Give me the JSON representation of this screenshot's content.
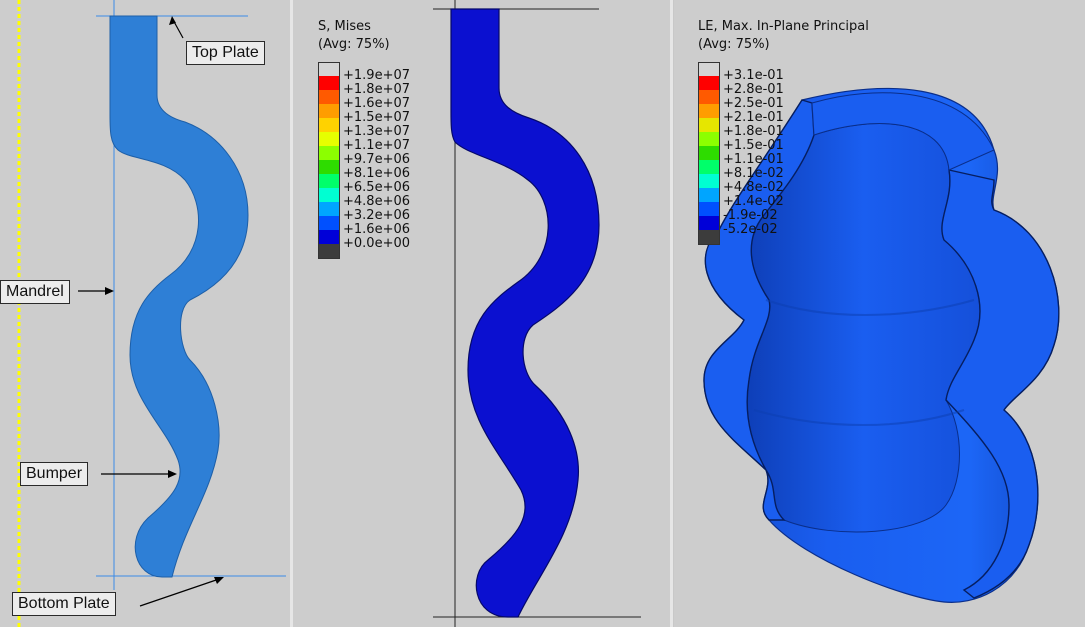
{
  "callouts": {
    "top_plate": "Top Plate",
    "mandrel": "Mandrel",
    "bumper": "Bumper",
    "bottom_plate": "Bottom Plate"
  },
  "stress_legend": {
    "title": "S, Mises",
    "subtitle": "(Avg: 75%)",
    "labels": [
      "+1.9e+07",
      "+1.8e+07",
      "+1.6e+07",
      "+1.5e+07",
      "+1.3e+07",
      "+1.1e+07",
      "+9.7e+06",
      "+8.1e+06",
      "+6.5e+06",
      "+4.8e+06",
      "+3.2e+06",
      "+1.6e+06",
      "+0.0e+00"
    ]
  },
  "strain_legend": {
    "title": "LE, Max. In-Plane Principal",
    "subtitle": "(Avg: 75%)",
    "labels": [
      "+3.1e-01",
      "+2.8e-01",
      "+2.5e-01",
      "+2.1e-01",
      "+1.8e-01",
      "+1.5e-01",
      "+1.1e-01",
      "+8.1e-02",
      "+4.8e-02",
      "+1.4e-02",
      "-1.9e-02",
      "-5.2e-02"
    ]
  },
  "colors": {
    "background": "#cdcdcd",
    "bumper_model": "#2e7fd6",
    "stress_result": "#0b10d0",
    "strain_result": "#1a5ef0",
    "mandrel_line": "#ffff00",
    "contour_scale": [
      "#d4d4d4",
      "#ff0000",
      "#ff5a00",
      "#ff9d00",
      "#ffd200",
      "#e6ff00",
      "#8cff00",
      "#2edc00",
      "#00ff6a",
      "#00ffd2",
      "#00a5ff",
      "#0050ff",
      "#0000d8",
      "#3c3c3c"
    ]
  }
}
